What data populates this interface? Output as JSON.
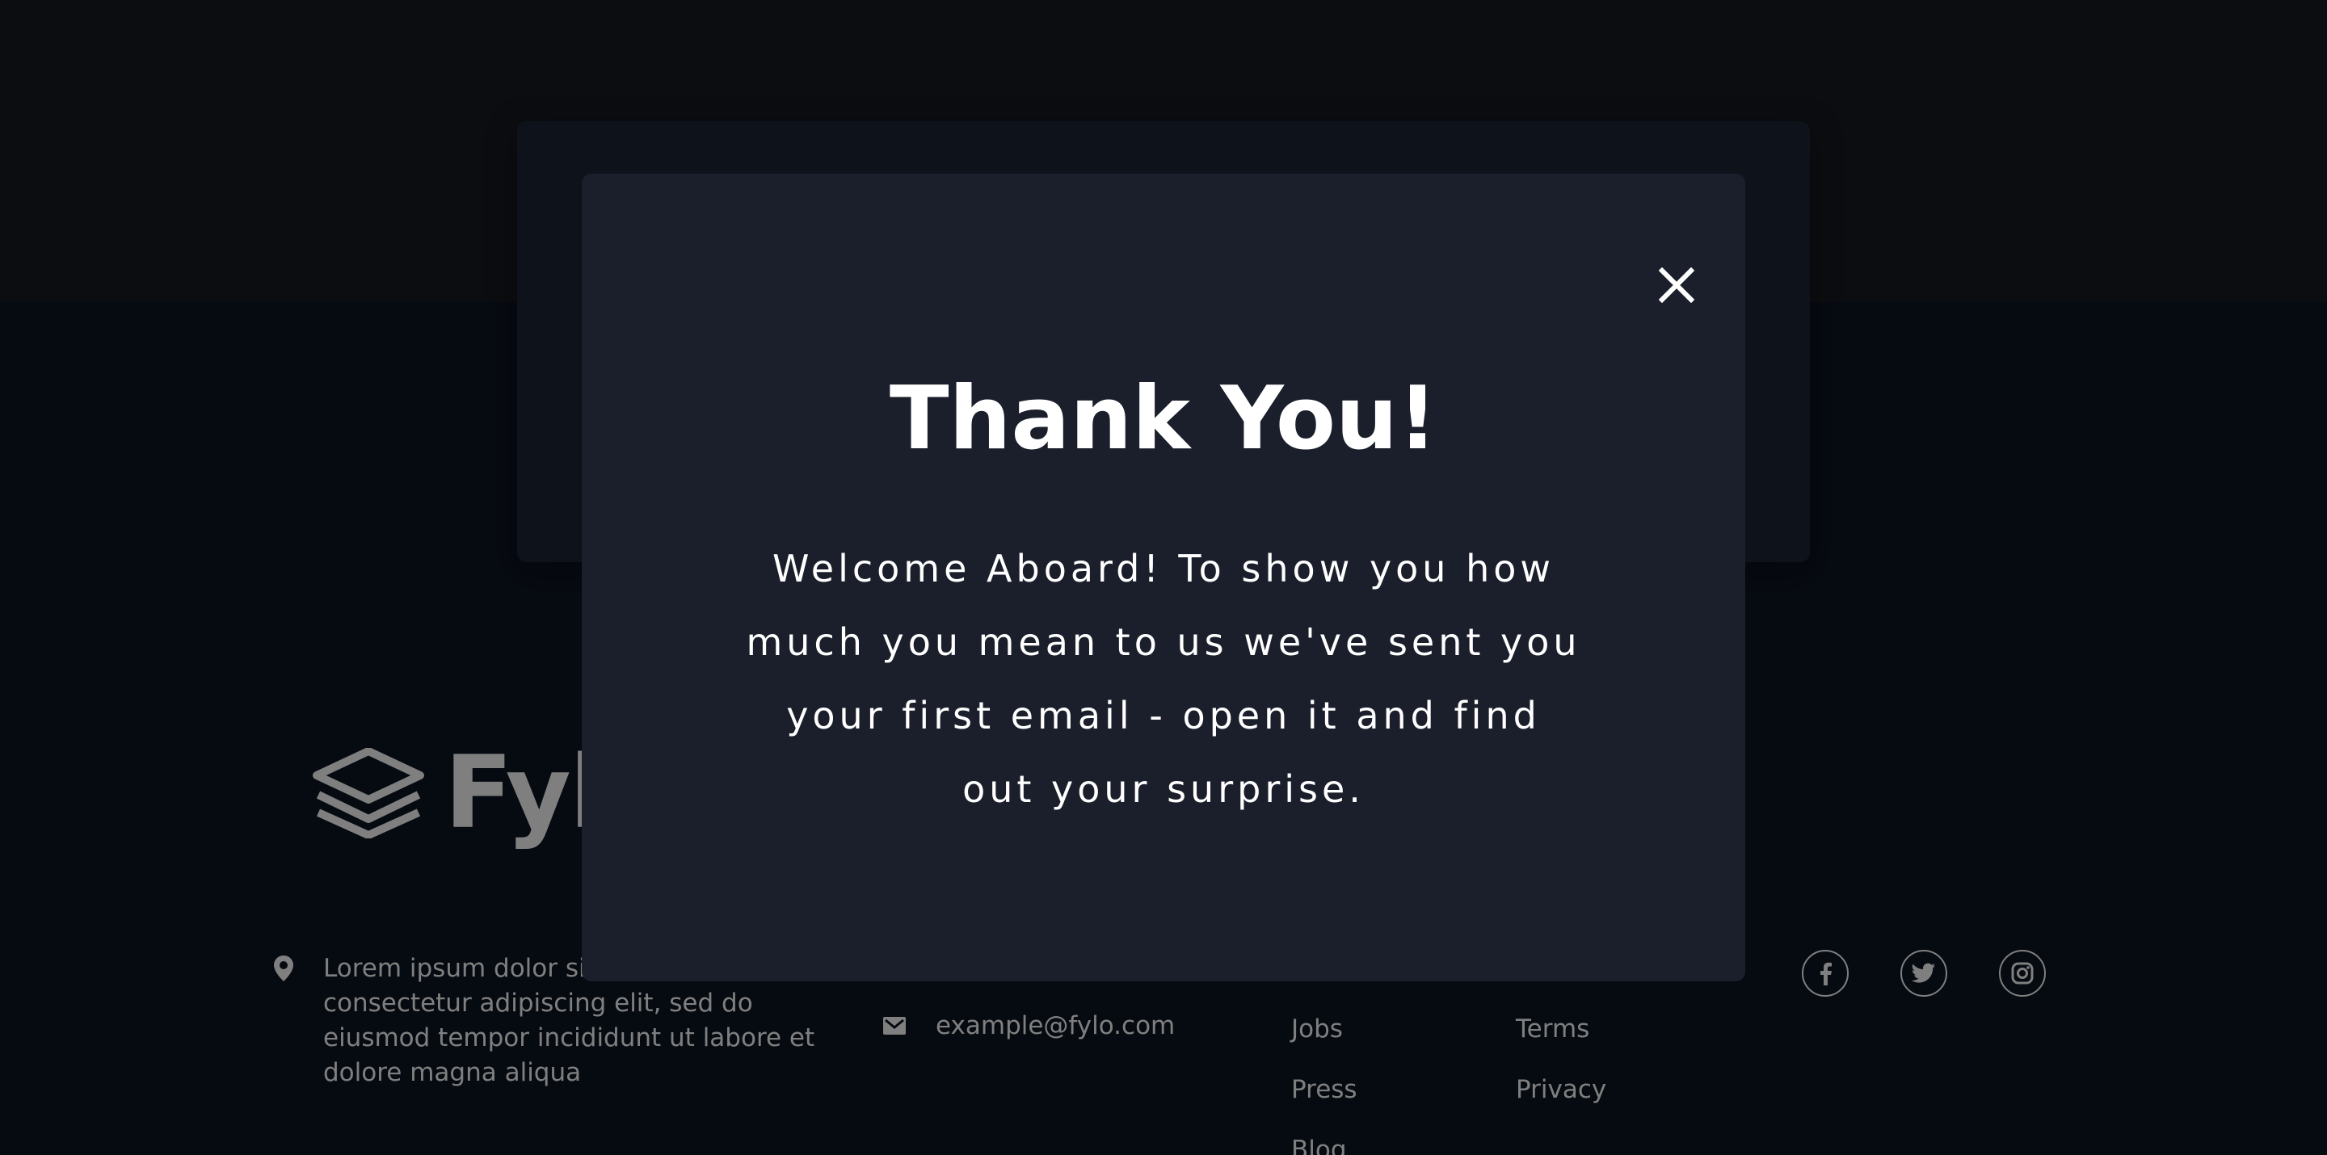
{
  "footer": {
    "logo_text": "Fylo",
    "address": "Lorem ipsum dolor sit amet, consectetur adipiscing elit, sed do eiusmod tempor incididunt ut labore et dolore magna aliqua",
    "email": "example@fylo.com",
    "links_col1": [
      "Jobs",
      "Press",
      "Blog"
    ],
    "links_col2": [
      "Terms",
      "Privacy"
    ],
    "social_icons": [
      "facebook-icon",
      "twitter-icon",
      "instagram-icon"
    ]
  },
  "modal": {
    "title": "Thank You!",
    "message": "Welcome Aboard! To show you how much you mean to us we've sent you your first email - open it and find out your surprise.",
    "close_icon": "close-icon"
  },
  "colors": {
    "overlay": "#000000",
    "modal_bg": "#1b1f2b",
    "footer_bg": "#0d1523",
    "text": "#ffffff"
  }
}
